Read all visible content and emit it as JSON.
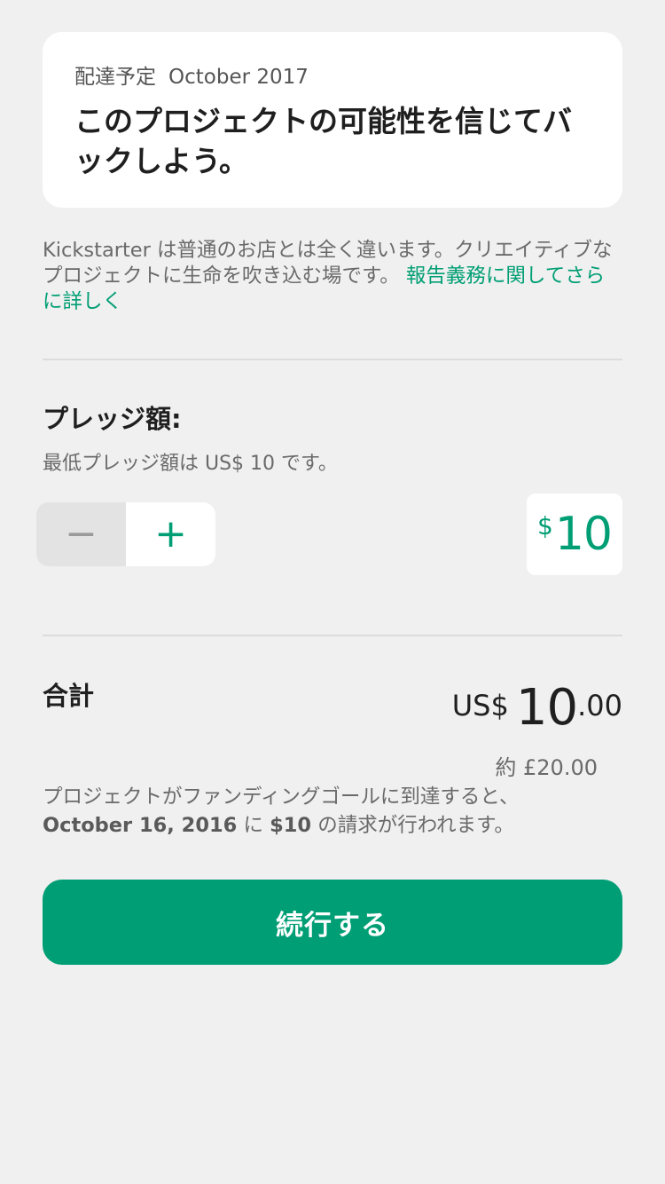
{
  "reward_card": {
    "delivery_label": "配達予定",
    "delivery_date": "October 2017",
    "title": "このプロジェクトの可能性を信じてバックしよう。"
  },
  "info": {
    "text": "Kickstarter は普通のお店とは全く違います。クリエイティブなプロジェクトに生命を吹き込む場です。",
    "link": "報告義務に関してさらに詳しく"
  },
  "pledge": {
    "label": "プレッジ額:",
    "minimum_note": "最低プレッジ額は US$ 10 です。",
    "decrement_symbol": "−",
    "increment_symbol": "+",
    "currency_symbol": "$",
    "amount": "10"
  },
  "total": {
    "label": "合計",
    "currency": "US$",
    "amount_integer": "10",
    "amount_decimal": ".00",
    "approx": "約 £20.00"
  },
  "charge_note": {
    "line1": "プロジェクトがファンディングゴールに到達すると、",
    "date": "October 16, 2016",
    "connector": " に ",
    "amount": "$10",
    "suffix": " の請求が行われます。"
  },
  "continue_button": {
    "label": "続行する"
  },
  "colors": {
    "accent": "#009e74",
    "background": "#f0f0f0",
    "card": "#ffffff"
  }
}
